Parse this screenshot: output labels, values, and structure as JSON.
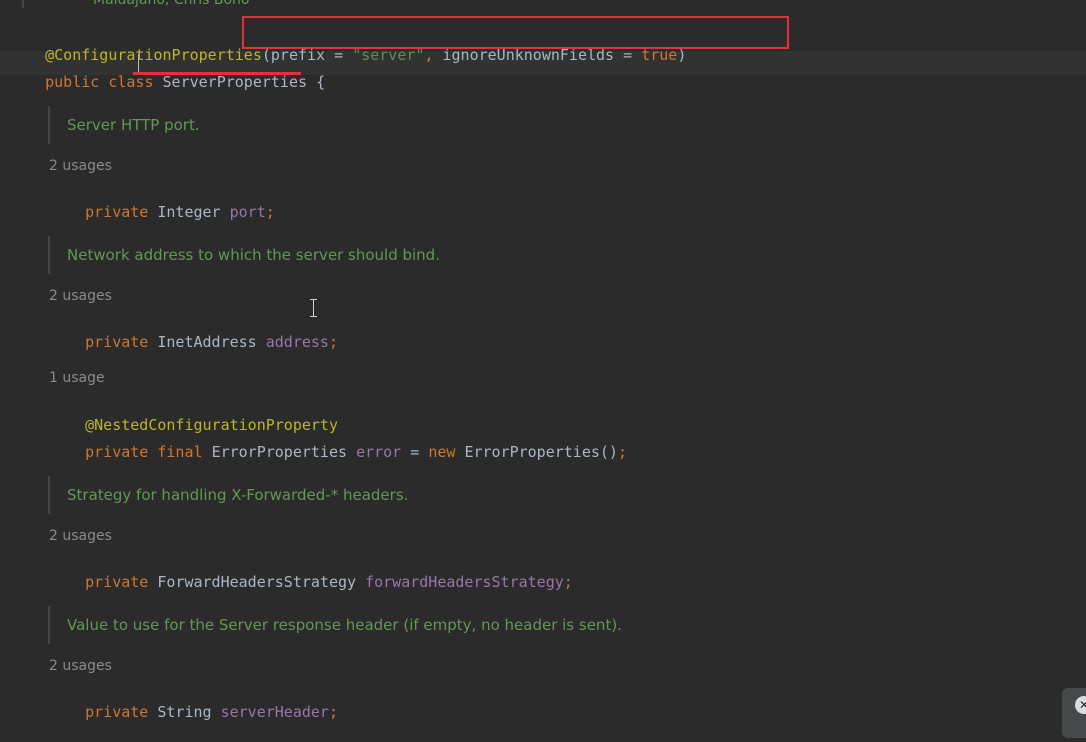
{
  "header_comment": {
    "authors": "Maldajano, Chris Bono"
  },
  "annotation_line": {
    "annotation": "@ConfigurationProperties",
    "open_paren": "(",
    "prefix_key": "prefix",
    "equals": " = ",
    "prefix_value": "\"server\"",
    "comma": ", ",
    "ignore_key": "ignoreUnknownFields",
    "ignore_value": "true",
    "close_paren": ")"
  },
  "class_line": {
    "kw_public": "public",
    "kw_class": "class",
    "class_name": "ServerProperties",
    "brace": "{"
  },
  "fields": [
    {
      "doc": "Server HTTP port.",
      "usages": "2 usages",
      "modifier": "private",
      "type": "Integer",
      "name": "port",
      "semicolon": ";"
    },
    {
      "doc": "Network address to which the server should bind.",
      "usages": "2 usages",
      "modifier": "private",
      "type": "InetAddress",
      "name": "address",
      "semicolon": ";"
    },
    {
      "usages": "1 usage",
      "annotation": "@NestedConfigurationProperty",
      "modifier": "private",
      "final": "final",
      "type": "ErrorProperties",
      "name": "error",
      "equals": " = ",
      "new": "new",
      "ctor": "ErrorProperties()",
      "semicolon": ";"
    },
    {
      "doc": "Strategy for handling X-Forwarded-* headers.",
      "usages": "2 usages",
      "modifier": "private",
      "type": "ForwardHeadersStrategy",
      "name": "forwardHeadersStrategy",
      "semicolon": ";"
    },
    {
      "doc": "Value to use for the Server response header (if empty, no header is sent).",
      "usages": "2 usages",
      "modifier": "private",
      "type": "String",
      "name": "serverHeader",
      "semicolon": ";"
    }
  ],
  "colors": {
    "background": "#2b2b2b",
    "keyword": "#cc7832",
    "annotation": "#bbb529",
    "string": "#6a8759",
    "field": "#9876aa",
    "text": "#a9b7c6",
    "doc": "#629755",
    "highlight": "#e0313c"
  },
  "icons": {
    "floating_button": "close-x-icon"
  }
}
